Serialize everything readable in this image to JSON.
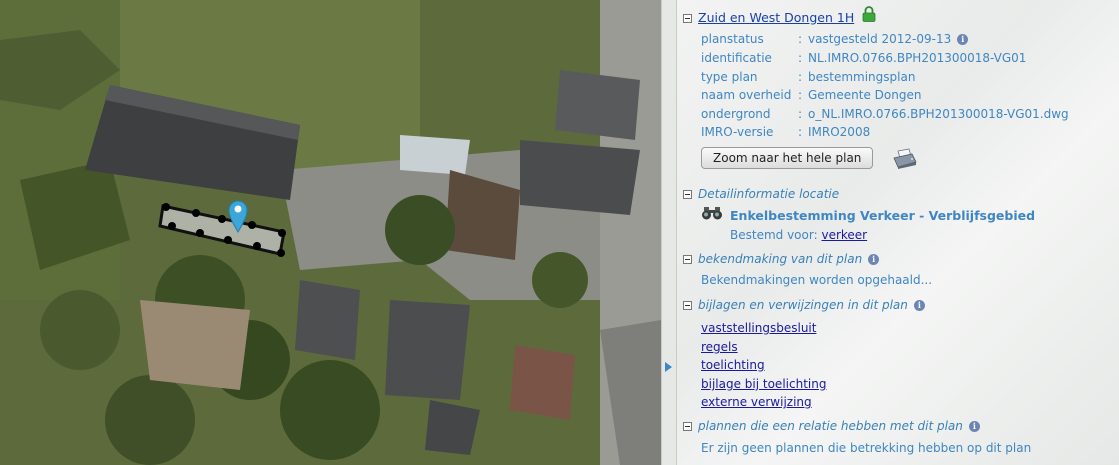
{
  "plan": {
    "title": "Zuid en West Dongen 1H",
    "properties": [
      {
        "key": "planstatus",
        "value": "vastgesteld 2012-09-13",
        "info": true
      },
      {
        "key": "identificatie",
        "value": "NL.IMRO.0766.BPH201300018-VG01",
        "info": false
      },
      {
        "key": "type plan",
        "value": "bestemmingsplan",
        "info": false
      },
      {
        "key": "naam overheid",
        "value": "Gemeente Dongen",
        "info": false
      },
      {
        "key": "ondergrond",
        "value": "o_NL.IMRO.0766.BPH201300018-VG01.dwg",
        "info": false
      },
      {
        "key": "IMRO-versie",
        "value": "IMRO2008",
        "info": false
      }
    ],
    "zoom_button": "Zoom naar het hele plan"
  },
  "detail": {
    "heading": "Detailinformatie locatie",
    "bestemming": "Enkelbestemming Verkeer - Verblijfsgebied",
    "bestemd_label": "Bestemd voor:",
    "bestemd_link": "verkeer"
  },
  "bekendmaking": {
    "heading": "bekendmaking van dit plan",
    "text": "Bekendmakingen worden opgehaald..."
  },
  "bijlagen": {
    "heading": "bijlagen en verwijzingen in dit plan",
    "links": [
      "vaststellingsbesluit",
      "regels",
      "toelichting",
      "bijlage bij toelichting",
      "externe verwijzing"
    ]
  },
  "relaties": {
    "heading": "plannen die een relatie hebben met dit plan",
    "text": "Er zijn geen plannen die betrekking hebben op dit plan"
  },
  "colors": {
    "link": "#1a3faa",
    "label": "#3f86c2",
    "heading": "#3a80b8",
    "lock": "#3aa83a"
  },
  "icons": [
    "lock-icon",
    "info-icon",
    "printer-icon",
    "binoculars-icon",
    "map-pin-icon",
    "collapse-arrow-icon"
  ]
}
